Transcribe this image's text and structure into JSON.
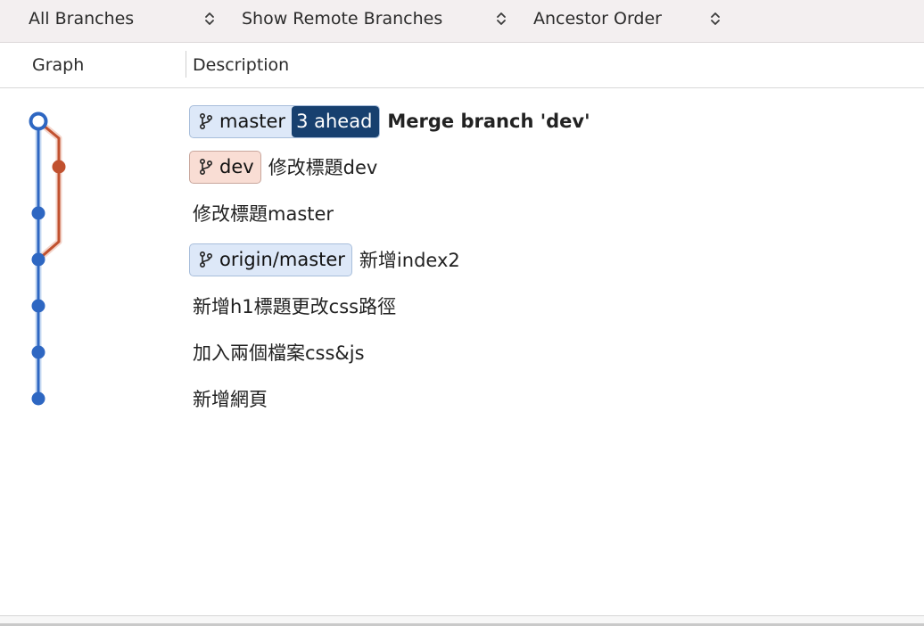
{
  "toolbar": {
    "branches_filter": "All Branches",
    "remote_filter": "Show Remote Branches",
    "order_filter": "Ancestor Order"
  },
  "columns": {
    "graph": "Graph",
    "description": "Description"
  },
  "colors": {
    "main_line": "#2e67c2",
    "branch_line": "#c1512f",
    "ahead_badge": "#17406f"
  },
  "commits": [
    {
      "branch": "master",
      "ahead": "3 ahead",
      "message": "Merge branch 'dev'"
    },
    {
      "branch": "dev",
      "message": "修改標題dev"
    },
    {
      "message": "修改標題master"
    },
    {
      "branch": "origin/master",
      "message": "新增index2"
    },
    {
      "message": "新增h1標題更改css路徑"
    },
    {
      "message": "加入兩個檔案css&js"
    },
    {
      "message": "新增網頁"
    }
  ]
}
